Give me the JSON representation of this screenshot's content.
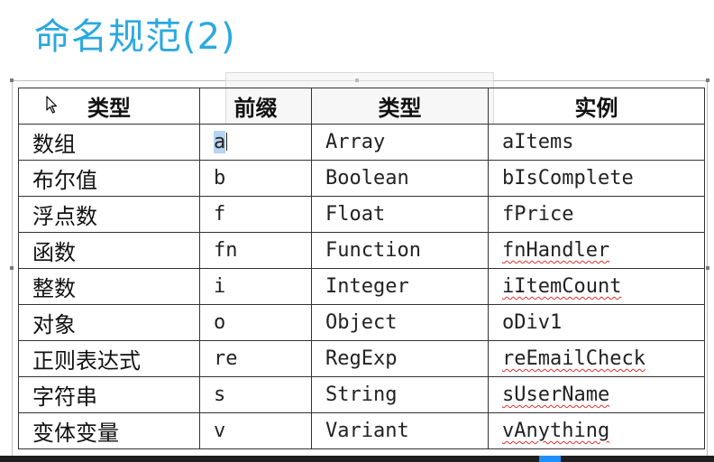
{
  "title": "命名规范(2)",
  "table": {
    "headers": [
      "类型",
      "前缀",
      "类型",
      "实例"
    ],
    "rows": [
      {
        "zh": "数组",
        "prefix": "a",
        "type": "Array",
        "example": "aItems"
      },
      {
        "zh": "布尔值",
        "prefix": "b",
        "type": "Boolean",
        "example": "bIsComplete"
      },
      {
        "zh": "浮点数",
        "prefix": "f",
        "type": "Float",
        "example": "fPrice"
      },
      {
        "zh": "函数",
        "prefix": "fn",
        "type": "Function",
        "example": "fnHandler"
      },
      {
        "zh": "整数",
        "prefix": "i",
        "type": "Integer",
        "example": "iItemCount"
      },
      {
        "zh": "对象",
        "prefix": "o",
        "type": "Object",
        "example": "oDiv1"
      },
      {
        "zh": "正则表达式",
        "prefix": "re",
        "type": "RegExp",
        "example": "reEmailCheck"
      },
      {
        "zh": "字符串",
        "prefix": "s",
        "type": "String",
        "example": "sUserName"
      },
      {
        "zh": "变体变量",
        "prefix": "v",
        "type": "Variant",
        "example": "vAnything"
      }
    ]
  },
  "colors": {
    "title": "#2aa9e0",
    "spellcheck": "#e03030",
    "selection": "#b7d3f0"
  }
}
